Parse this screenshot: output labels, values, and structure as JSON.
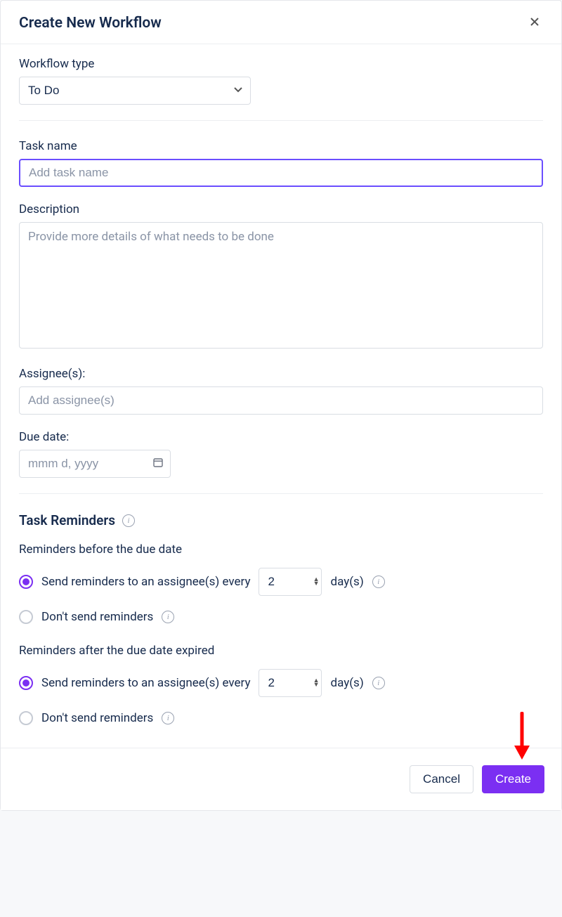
{
  "modal": {
    "title": "Create New Workflow"
  },
  "fields": {
    "workflow_type": {
      "label": "Workflow type",
      "value": "To Do"
    },
    "task_name": {
      "label": "Task name",
      "placeholder": "Add task name",
      "value": ""
    },
    "description": {
      "label": "Description",
      "placeholder": "Provide more details of what needs to be done",
      "value": ""
    },
    "assignees": {
      "label": "Assignee(s):",
      "placeholder": "Add assignee(s)",
      "value": ""
    },
    "due_date": {
      "label": "Due date:",
      "placeholder": "mmm d, yyyy",
      "value": ""
    }
  },
  "reminders": {
    "section_title": "Task Reminders",
    "before": {
      "heading": "Reminders before the due date",
      "opt_send_prefix": "Send reminders to an assignee(s) every",
      "opt_send_value": "2",
      "opt_send_suffix": "day(s)",
      "opt_none": "Don't send reminders",
      "selected": "send"
    },
    "after": {
      "heading": "Reminders after the due date expired",
      "opt_send_prefix": "Send reminders to an assignee(s) every",
      "opt_send_value": "2",
      "opt_send_suffix": "day(s)",
      "opt_none": "Don't send reminders",
      "selected": "send"
    }
  },
  "footer": {
    "cancel": "Cancel",
    "create": "Create"
  }
}
